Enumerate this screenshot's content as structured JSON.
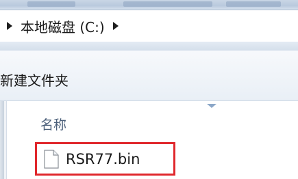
{
  "address_bar": {
    "breadcrumb": [
      {
        "label": "本地磁盘 (C:)"
      }
    ]
  },
  "toolbar": {
    "new_folder_label": "新建文件夹"
  },
  "file_list": {
    "columns": [
      {
        "label": "名称",
        "sorted": "ascending"
      }
    ],
    "items": [
      {
        "name": "RSR77.bin",
        "icon": "generic-file-icon",
        "highlighted": true,
        "highlight_color": "#e0272c"
      }
    ]
  }
}
